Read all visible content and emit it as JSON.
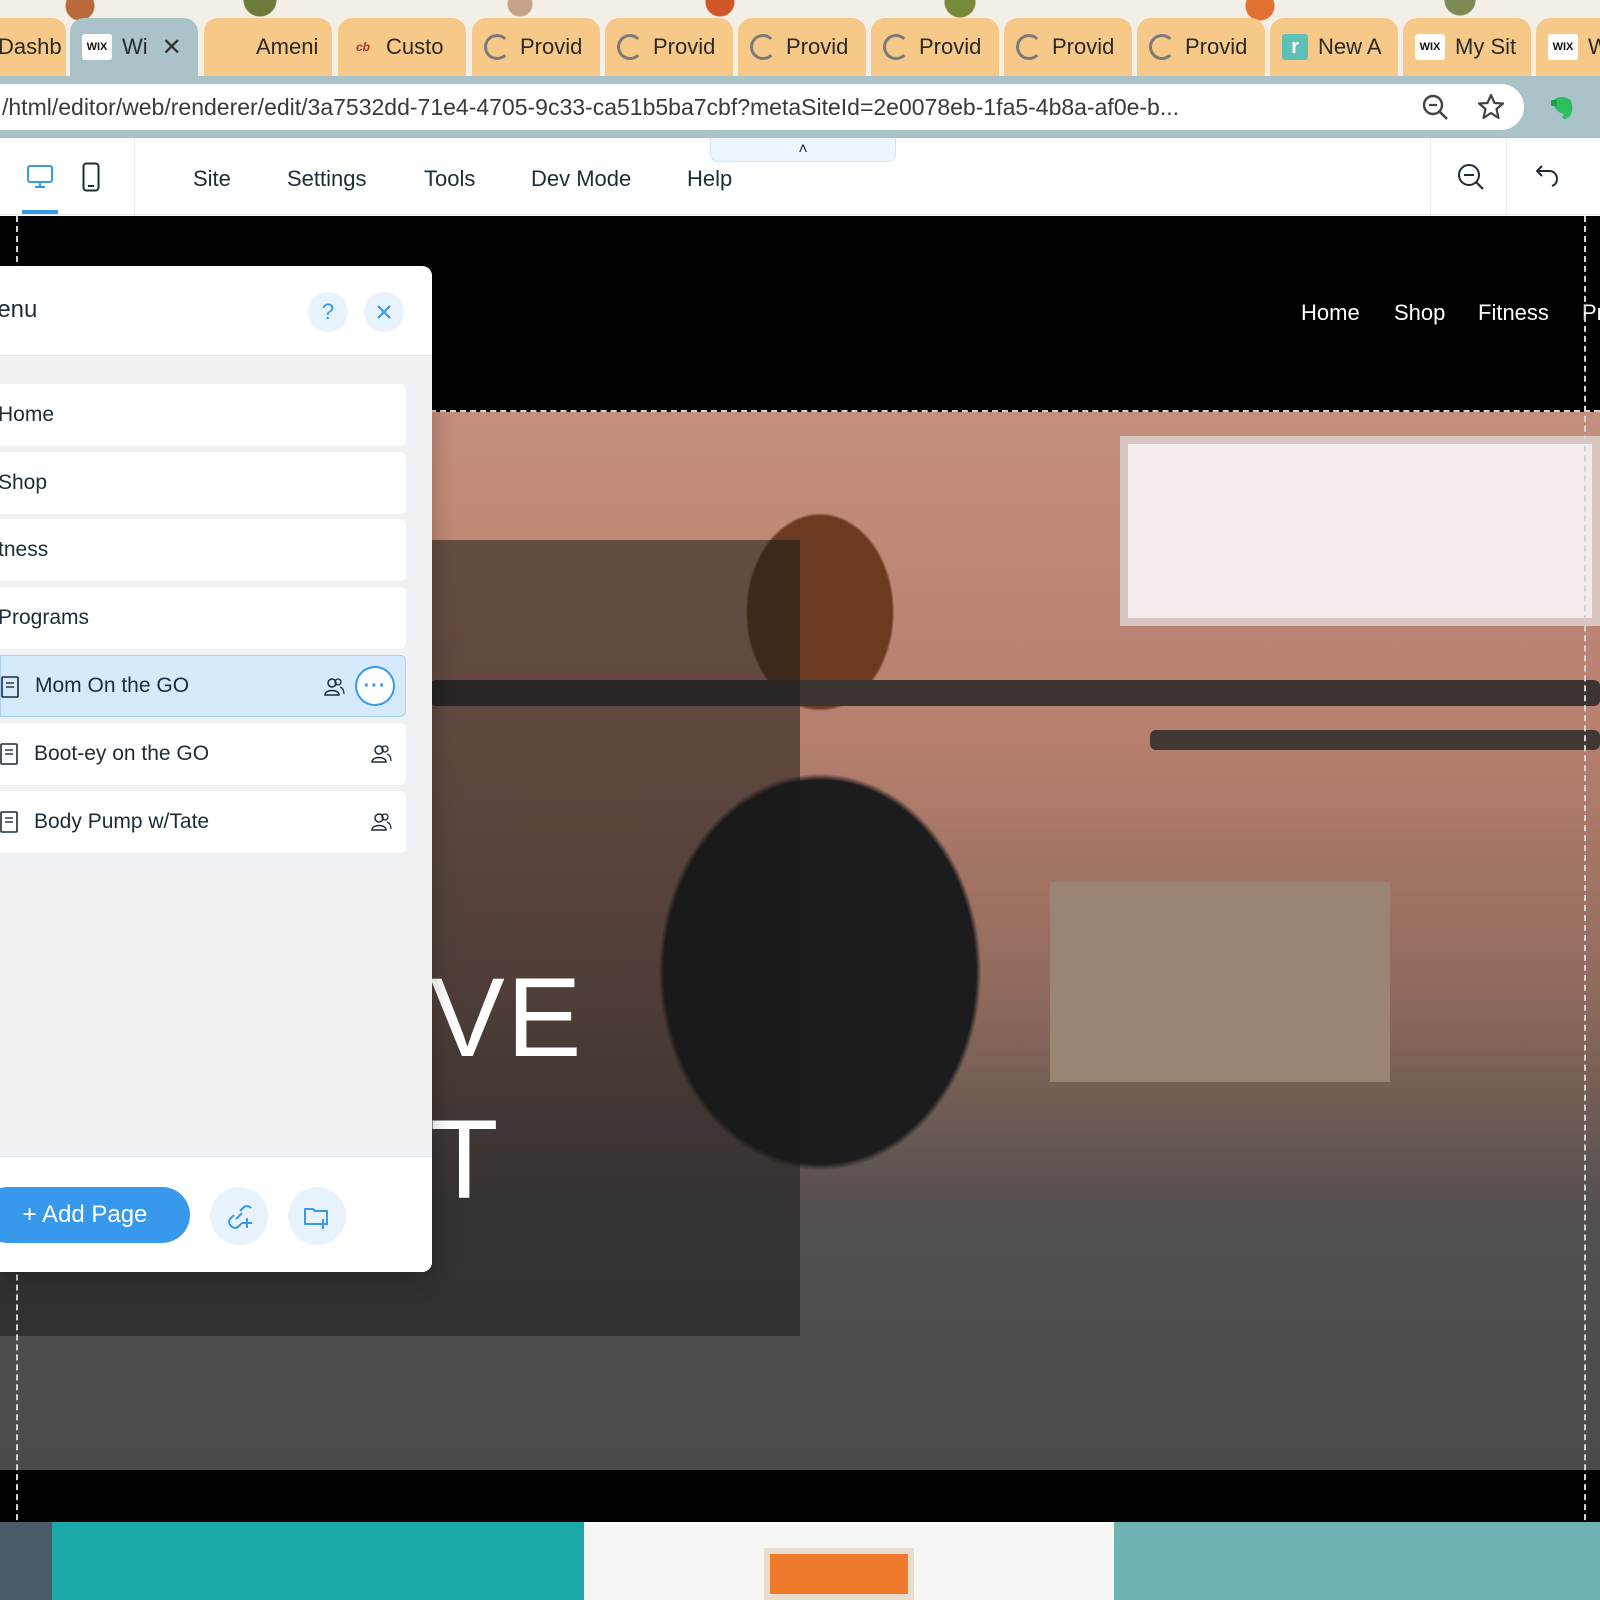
{
  "browser": {
    "tabs": [
      {
        "label": "Dashb",
        "favicon": "none"
      },
      {
        "label": "Wi",
        "favicon": "wix",
        "active": true
      },
      {
        "label": "Ameni",
        "favicon": "none"
      },
      {
        "label": "Custo",
        "favicon": "cb"
      },
      {
        "label": "Provid",
        "favicon": "c"
      },
      {
        "label": "Provid",
        "favicon": "c"
      },
      {
        "label": "Provid",
        "favicon": "c"
      },
      {
        "label": "Provid",
        "favicon": "c"
      },
      {
        "label": "Provid",
        "favicon": "c"
      },
      {
        "label": "Provid",
        "favicon": "c"
      },
      {
        "label": "New A",
        "favicon": "r"
      },
      {
        "label": "My Sit",
        "favicon": "wix"
      },
      {
        "label": "W",
        "favicon": "wix"
      }
    ],
    "wix_favicon_text": "WIX",
    "r_favicon_text": "r",
    "cb_favicon_text": "cb",
    "tab_close_glyph": "✕",
    "url": "/html/editor/web/renderer/edit/3a7532dd-71e4-4705-9c33-ca51b5ba7cbf?metaSiteId=2e0078eb-1fa5-4b8a-af0e-b..."
  },
  "editor": {
    "top_menu": [
      "Site",
      "Settings",
      "Tools",
      "Dev Mode",
      "Help"
    ],
    "collapse_glyph": "˄",
    "accent_color": "#3899ec"
  },
  "menu_panel": {
    "title": "lenu",
    "help_glyph": "?",
    "pages": [
      {
        "label": "Home",
        "type": "main"
      },
      {
        "label": "Shop",
        "type": "main"
      },
      {
        "label": "tness",
        "type": "main"
      },
      {
        "label": "Programs",
        "type": "main"
      },
      {
        "label": "Mom On the GO",
        "type": "sub",
        "selected": true
      },
      {
        "label": "Boot-ey on the GO",
        "type": "sub"
      },
      {
        "label": "Body Pump w/Tate",
        "type": "sub"
      }
    ],
    "more_glyph": "···",
    "add_page_label": "+ Add Page"
  },
  "site_preview": {
    "nav": [
      "Home",
      "Shop",
      "Fitness",
      "Pr"
    ],
    "hero_text_line1": "VE",
    "hero_text_line2": "T"
  }
}
